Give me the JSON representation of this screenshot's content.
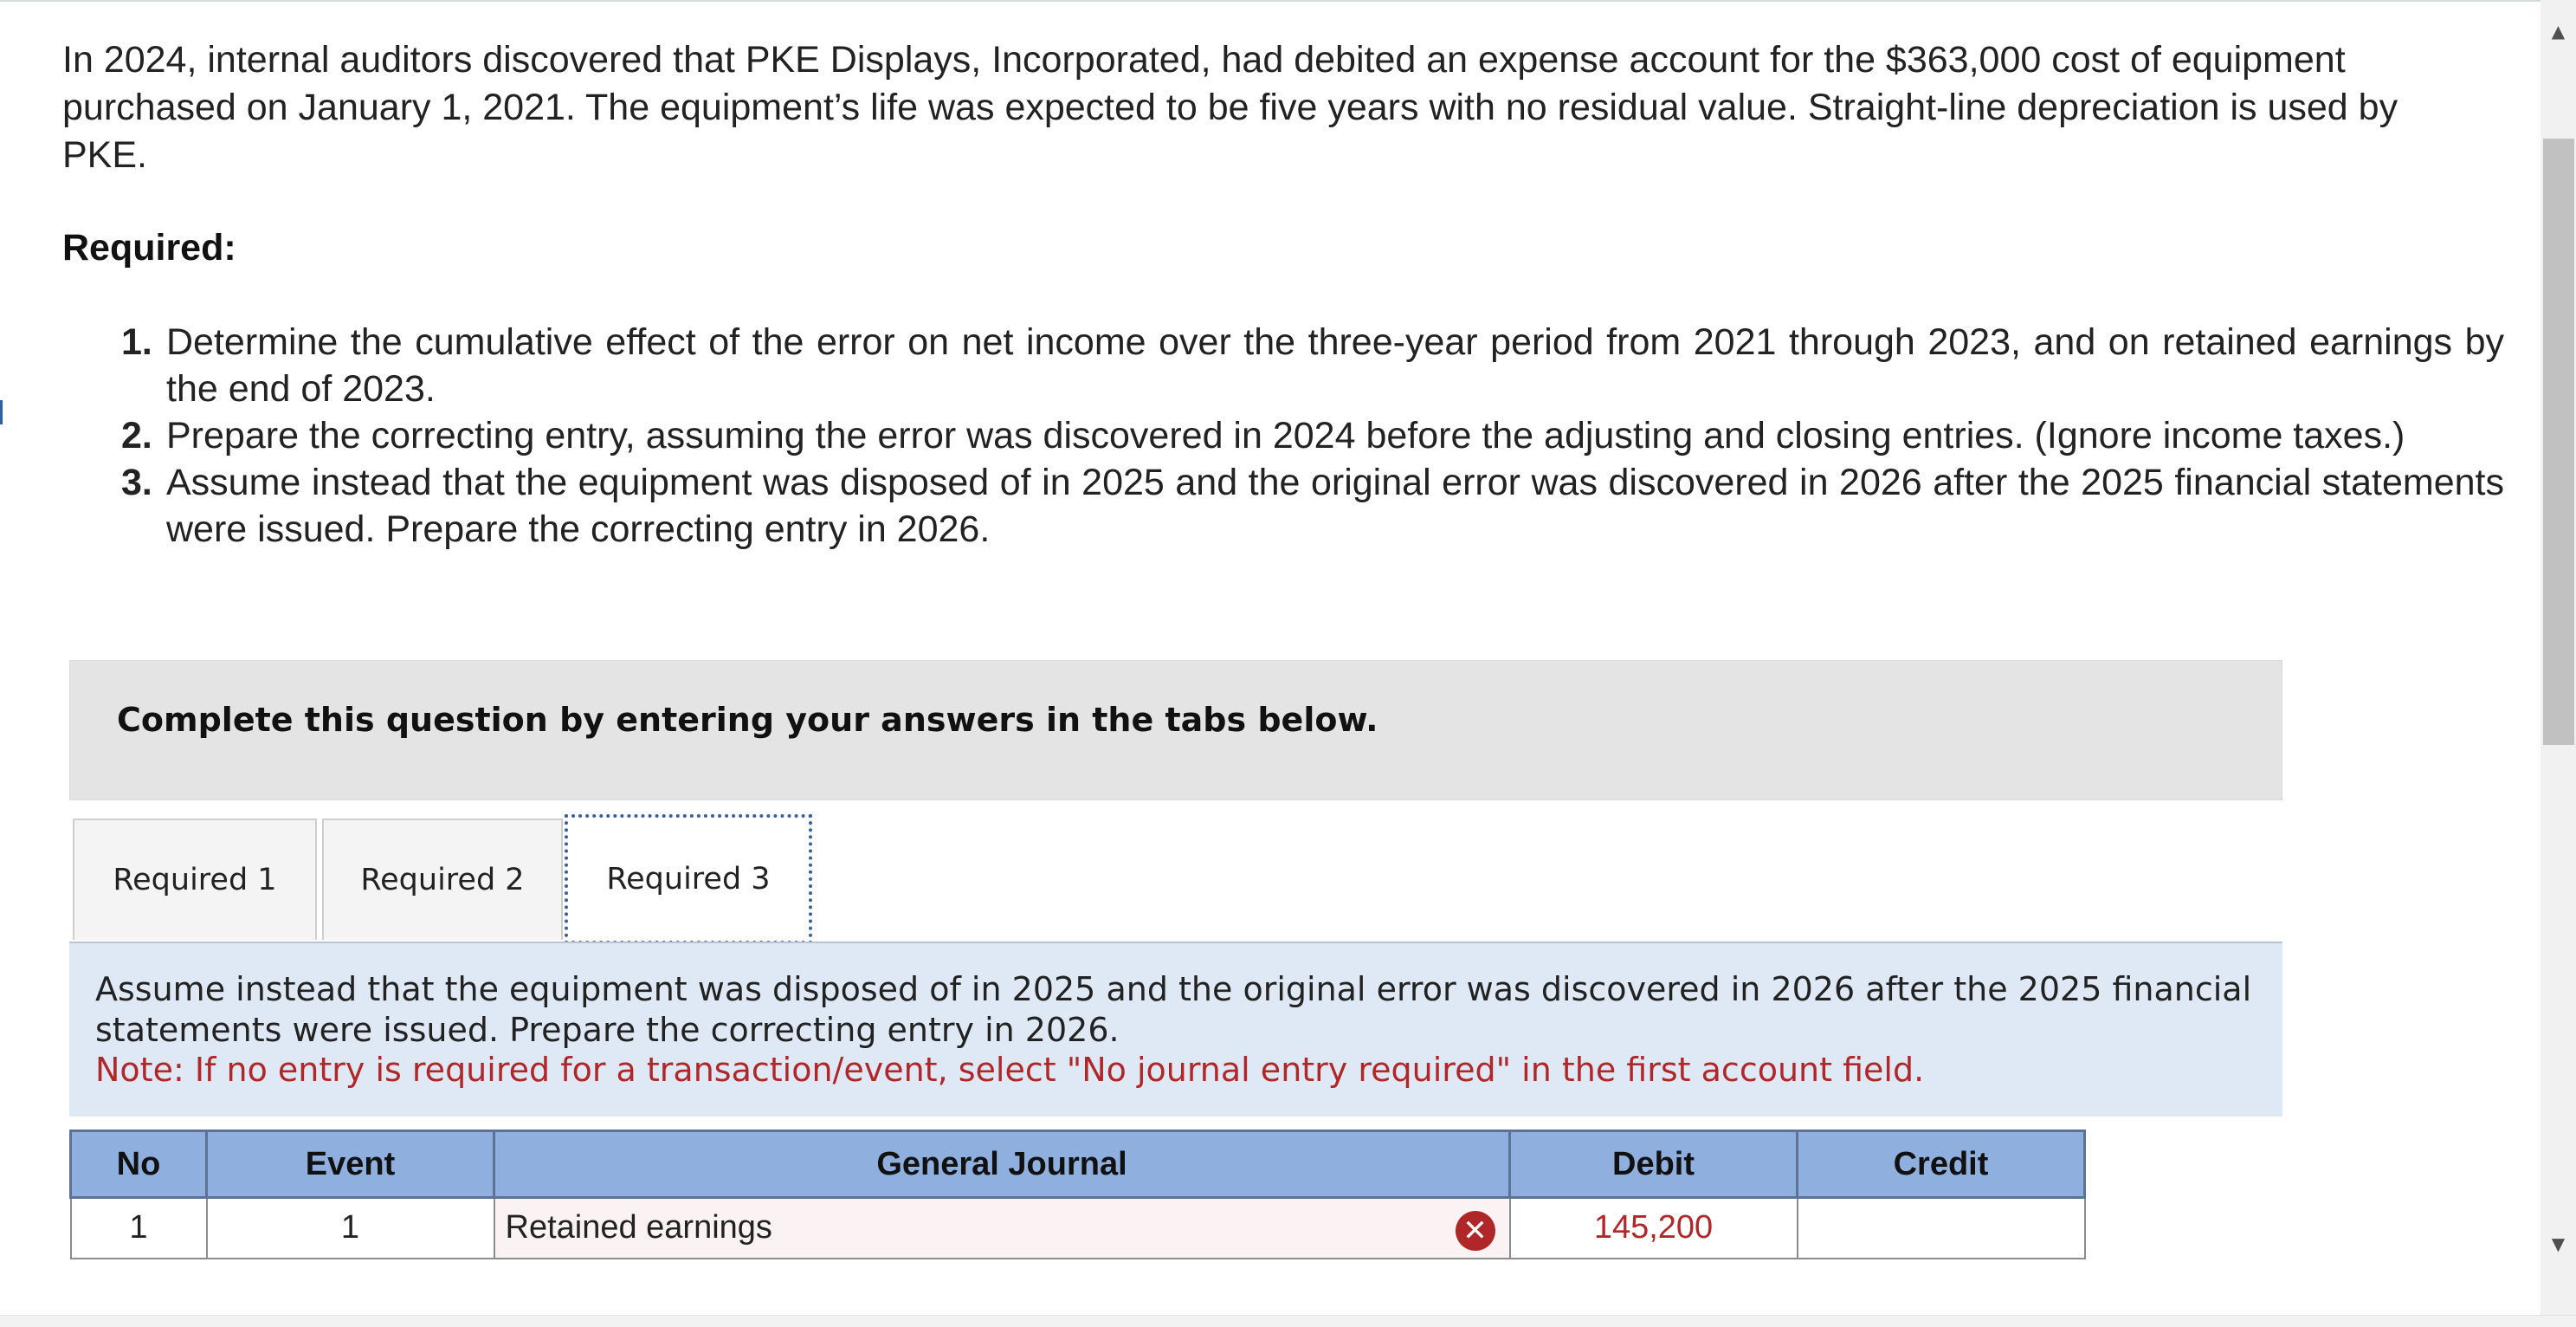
{
  "problem": {
    "intro": "In 2024, internal auditors discovered that PKE Displays, Incorporated, had debited an expense account for the $363,000 cost of equipment purchased on January 1, 2021. The equipment’s life was expected to be five years with no residual value. Straight-line depreciation is used by PKE.",
    "required_heading": "Required:",
    "items": [
      {
        "num": "1.",
        "text": "Determine the cumulative effect of the error on net income over the three-year period from 2021 through 2023, and on retained earnings by the end of 2023."
      },
      {
        "num": "2.",
        "text": "Prepare the correcting entry, assuming the error was discovered in 2024 before the adjusting and closing entries. (Ignore income taxes.)"
      },
      {
        "num": "3.",
        "text": "Assume instead that the equipment was disposed of in 2025 and the original error was discovered in 2026 after the 2025 financial statements were issued. Prepare the correcting entry in 2026."
      }
    ]
  },
  "instructions": {
    "complete_text": "Complete this question by entering your answers in the tabs below."
  },
  "tabs": [
    {
      "label": "Required 1",
      "active": false
    },
    {
      "label": "Required 2",
      "active": false
    },
    {
      "label": "Required 3",
      "active": true
    }
  ],
  "panel": {
    "text": "Assume instead that the equipment was disposed of in 2025 and the original error was discovered in 2026 after the 2025 financial statements were issued. Prepare the correcting entry in 2026.",
    "note": "Note: If no entry is required for a transaction/event, select \"No journal entry required\" in the first account field."
  },
  "journal": {
    "headers": {
      "no": "No",
      "event": "Event",
      "general_journal": "General Journal",
      "debit": "Debit",
      "credit": "Credit"
    },
    "rows": [
      {
        "no": "1",
        "event": "1",
        "account": "Retained earnings",
        "debit": "145,200",
        "credit": "",
        "status": "incorrect"
      }
    ]
  },
  "icons": {
    "error": "close-circle-icon",
    "scroll_up": "triangle-up-icon",
    "scroll_down": "triangle-down-icon"
  },
  "colors": {
    "error_red": "#b0272a",
    "header_blue": "#8fb0df",
    "panel_blue": "#dfe9f5"
  }
}
